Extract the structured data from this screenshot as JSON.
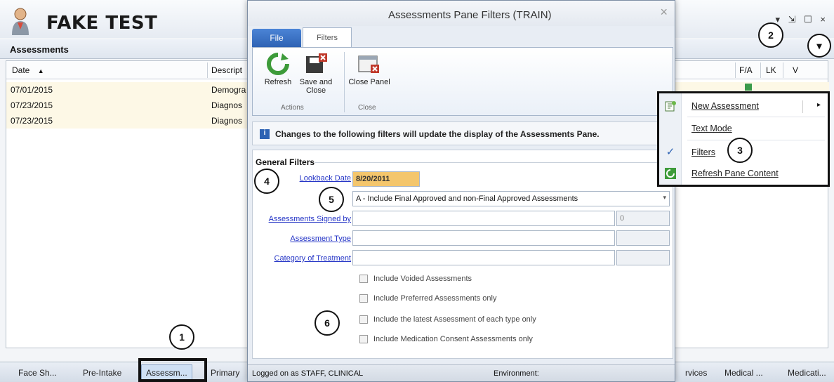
{
  "app": {
    "patient_name": "FAKE TEST",
    "window_controls": "▾ ⇲ ☐ ×",
    "pane_title": "Assessments",
    "grid_headers": {
      "date": "Date",
      "description": "Descript",
      "fa": "F/A",
      "lk": "LK",
      "v": "V"
    },
    "rows": [
      {
        "date": "07/01/2015",
        "description": "Demogra"
      },
      {
        "date": "07/23/2015",
        "description": "Diagnos"
      },
      {
        "date": "07/23/2015",
        "description": "Diagnos"
      }
    ],
    "tabs": [
      "Face Sh...",
      "Pre-Intake",
      "Assessm...",
      "Primary",
      "rvices",
      "Medical ...",
      "Medicati..."
    ]
  },
  "dialog": {
    "title": "Assessments Pane Filters (TRAIN)",
    "ribbon_tabs": {
      "file": "File",
      "filters": "Filters"
    },
    "buttons": {
      "refresh": "Refresh",
      "save_close": "Save and Close",
      "close_panel": "Close Panel"
    },
    "groups": {
      "actions": "Actions",
      "close": "Close"
    },
    "info_text": "Changes to the following filters will update the display of the Assessments Pane.",
    "general_filters_title": "General Filters",
    "fields": {
      "lookback_label": "Lookback Date",
      "lookback_value": "8/20/2011",
      "include_option": "A - Include Final Approved and non-Final Approved Assessments",
      "signed_by_label": "Assessments Signed by",
      "signed_by_count": "0",
      "type_label": "Assessment Type",
      "category_label": "Category of Treatment"
    },
    "checkboxes": [
      "Include Voided Assessments",
      "Include Preferred Assessments only",
      "Include the latest Assessment of each type only",
      "Include Medication Consent Assessments only"
    ],
    "status": {
      "logged_on": "Logged on as STAFF, CLINICAL",
      "environment": "Environment:"
    }
  },
  "context_menu": {
    "items": [
      {
        "label": "New Assessment",
        "icon": "new-assessment-icon",
        "has_submenu": true
      },
      {
        "label": "Text Mode",
        "icon": "",
        "has_submenu": false
      },
      {
        "label": "Filters",
        "icon": "checkmark-icon",
        "has_submenu": false
      },
      {
        "label": "Refresh Pane Content",
        "icon": "refresh-icon",
        "has_submenu": false
      }
    ]
  },
  "callouts": [
    "1",
    "2",
    "3",
    "4",
    "5",
    "6"
  ]
}
